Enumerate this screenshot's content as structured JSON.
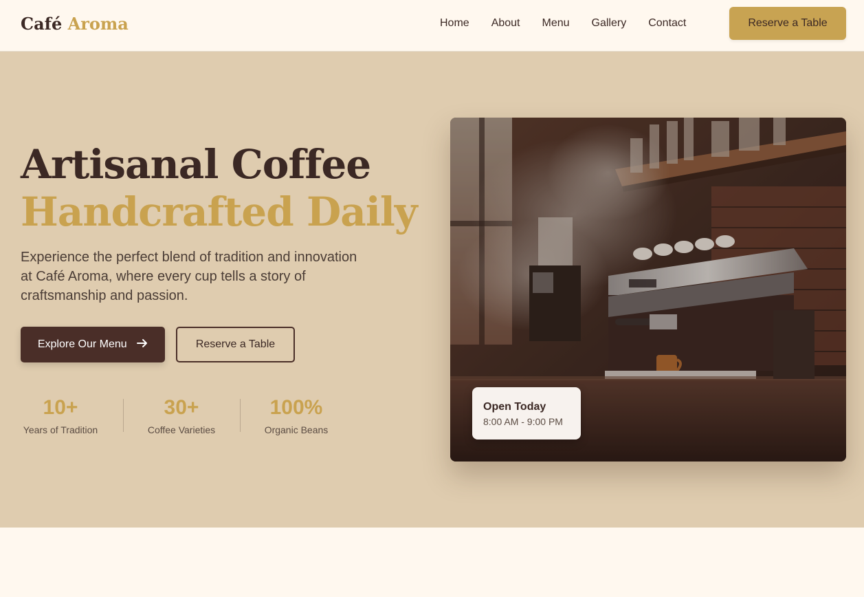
{
  "brand": {
    "name_first": "Café",
    "name_second": "Aroma"
  },
  "nav": {
    "links": [
      "Home",
      "About",
      "Menu",
      "Gallery",
      "Contact"
    ],
    "cta": "Reserve a Table"
  },
  "hero": {
    "headline_line1": "Artisanal Coffee",
    "headline_line2": "Handcrafted Daily",
    "description": "Experience the perfect blend of tradition and innovation at Café Aroma, where every cup tells a story of craftsmanship and passion.",
    "primary_button": "Explore Our Menu",
    "primary_button_icon": "arrow-right-icon",
    "secondary_button": "Reserve a Table",
    "stats": [
      {
        "value": "10+",
        "label": "Years of Tradition"
      },
      {
        "value": "30+",
        "label": "Coffee Varieties"
      },
      {
        "value": "100%",
        "label": "Organic Beans"
      }
    ]
  },
  "hours_card": {
    "title": "Open Today",
    "time": "8:00 AM - 9:00 PM"
  },
  "colors": {
    "brand_dark": "#3b2824",
    "accent_gold": "#c9a24f",
    "hero_bg": "#dfccaf",
    "page_bg": "#fff8ef"
  }
}
